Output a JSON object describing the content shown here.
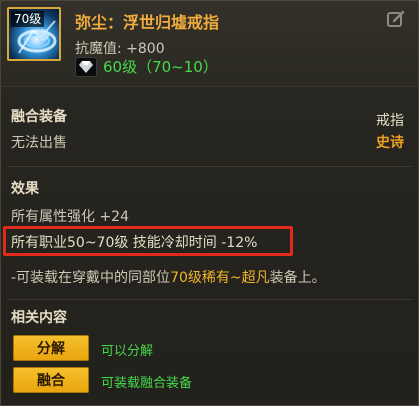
{
  "item": {
    "level_badge": "70级",
    "title": "弥尘：浮世归墟戒指",
    "attribute": "抗魔值: +800",
    "requirement": "60级（70~10）"
  },
  "fusion": {
    "heading": "融合装备",
    "sell_status": "无法出售",
    "slot": "戒指",
    "rarity": "史诗"
  },
  "effects": {
    "heading": "效果",
    "line1": "所有属性强化 +24",
    "line2": "所有职业50~70级 技能冷却时间 -12%",
    "line3_prefix": "-可装载在穿戴中的同部位",
    "line3_highlight": "70级稀有~超凡",
    "line3_suffix": "装备上。"
  },
  "related": {
    "heading": "相关内容",
    "actions": [
      {
        "label": "分解",
        "description": "可以分解"
      },
      {
        "label": "融合",
        "description": "可装载融合装备"
      }
    ]
  },
  "colors": {
    "title": "#f0ac3c",
    "green": "#47d94a",
    "highlight_border": "#e02a1a",
    "button": "#f5c12e"
  }
}
